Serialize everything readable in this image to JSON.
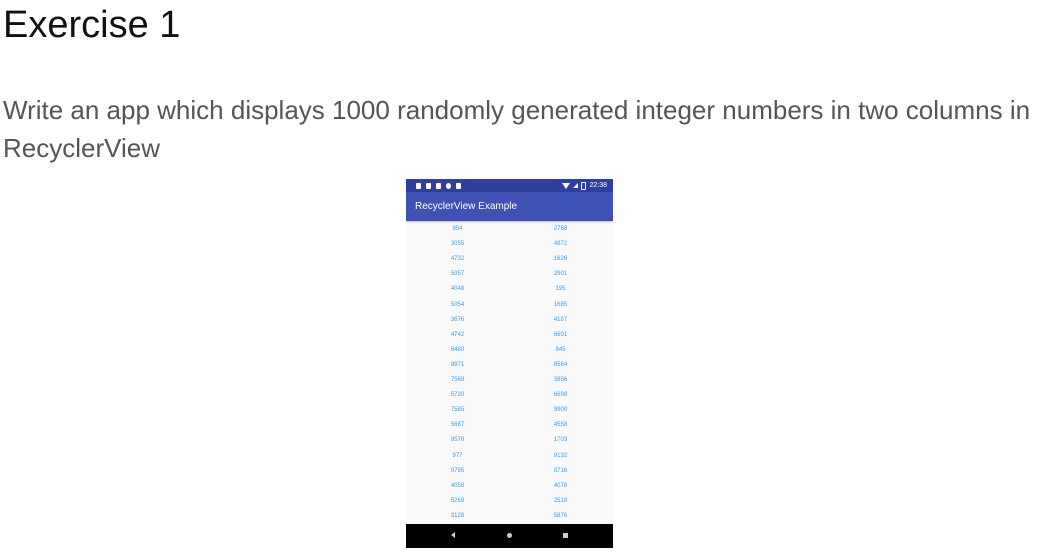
{
  "page": {
    "title": "Exercise 1",
    "description": "Write an app which displays 1000 randomly generated integer numbers in two columns in RecyclerView"
  },
  "phone": {
    "status_bar": {
      "time": "22:38",
      "icons_left": [
        "shield-icon",
        "image-icon",
        "notification-icon",
        "circle-icon",
        "clipboard-icon"
      ],
      "icons_right": [
        "wifi-icon",
        "signal-icon",
        "battery-icon"
      ],
      "color": "#303f9f"
    },
    "app_bar": {
      "title": "RecyclerView Example",
      "color": "#3f51b5"
    },
    "number_color": "#3d9be9",
    "numbers": [
      [
        "854",
        "2768"
      ],
      [
        "3055",
        "4872"
      ],
      [
        "4732",
        "1626"
      ],
      [
        "5957",
        "2901"
      ],
      [
        "4048",
        "195"
      ],
      [
        "5054",
        "1685"
      ],
      [
        "3676",
        "4187"
      ],
      [
        "4742",
        "6691"
      ],
      [
        "6480",
        "845"
      ],
      [
        "9971",
        "8584"
      ],
      [
        "7569",
        "3856"
      ],
      [
        "5720",
        "6698"
      ],
      [
        "7585",
        "9900"
      ],
      [
        "5687",
        "4558"
      ],
      [
        "9578",
        "1703"
      ],
      [
        "977",
        "9132"
      ],
      [
        "9795",
        "8716"
      ],
      [
        "4058",
        "4078"
      ],
      [
        "5269",
        "2518"
      ],
      [
        "3128",
        "5876"
      ]
    ],
    "nav_bar": {
      "buttons": [
        "back-icon",
        "home-icon",
        "recents-icon"
      ]
    }
  }
}
